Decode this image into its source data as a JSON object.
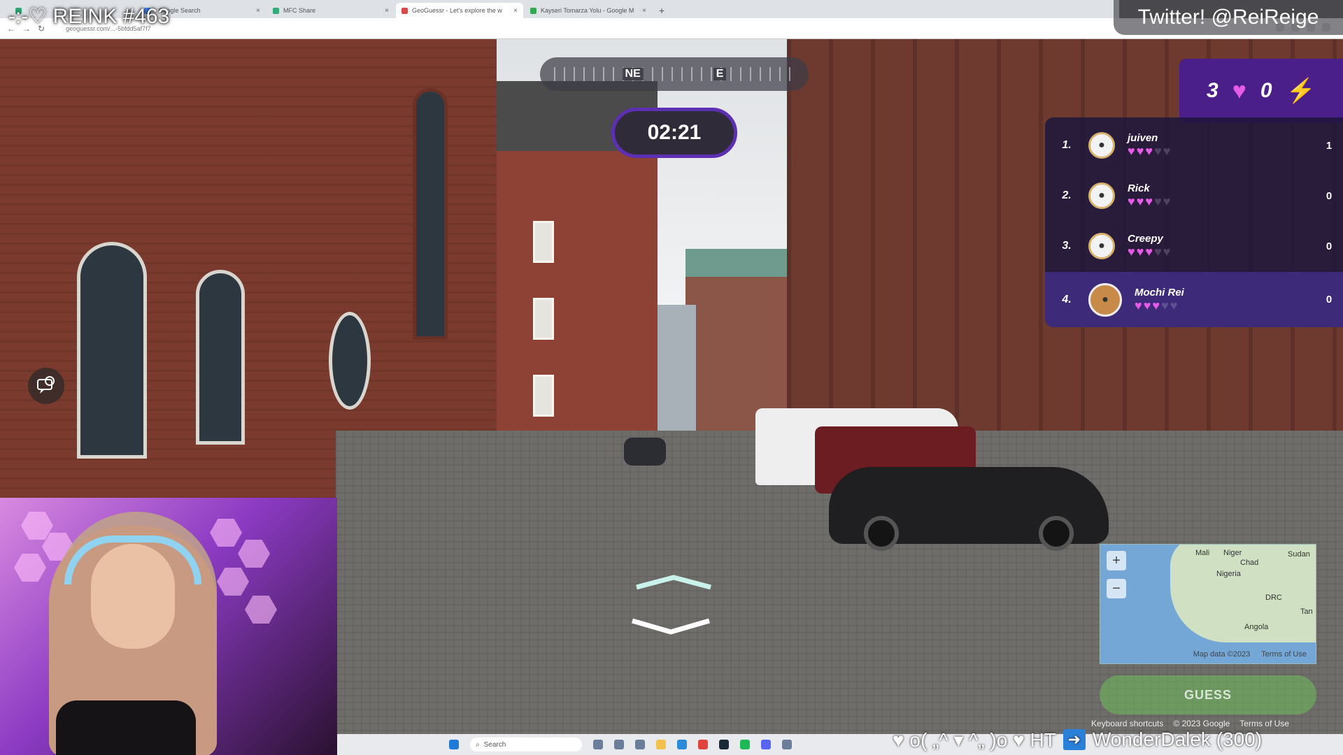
{
  "browser": {
    "tabs": [
      {
        "title": "",
        "active": false
      },
      {
        "title": "- Google Search",
        "active": false
      },
      {
        "title": "MFC Share",
        "active": false
      },
      {
        "title": "GeoGuessr - Let's explore the w",
        "active": true
      },
      {
        "title": "Kayseri Tomarza Yolu - Google M",
        "active": false
      }
    ],
    "url": "geoguessr.com/...-5bfdd5af7f7"
  },
  "game": {
    "compass": {
      "left": "NE",
      "right": "E"
    },
    "timer": "02:21",
    "lives": "3",
    "streak": "0",
    "leaderboard": [
      {
        "rank": "1.",
        "name": "juiven",
        "hearts_full": 3,
        "hearts_total": 5,
        "score": "1"
      },
      {
        "rank": "2.",
        "name": "Rick",
        "hearts_full": 3,
        "hearts_total": 5,
        "score": "0"
      },
      {
        "rank": "3.",
        "name": "Creepy",
        "hearts_full": 3,
        "hearts_total": 5,
        "score": "0"
      },
      {
        "rank": "4.",
        "name": "Mochi Rei",
        "hearts_full": 3,
        "hearts_total": 5,
        "score": "0"
      }
    ],
    "map": {
      "labels": [
        "Mali",
        "Niger",
        "Sudan",
        "Chad",
        "Nigeria",
        "DRC",
        "Angola",
        "Tan"
      ],
      "footer": {
        "data": "Map data ©2023",
        "terms": "Terms of Use"
      },
      "zoom_in": "+",
      "zoom_out": "−"
    },
    "guess_label": "GUESS",
    "google_footer": {
      "shortcuts": "Keyboard shortcuts",
      "copyright": "© 2023 Google",
      "terms": "Terms of Use"
    }
  },
  "taskbar": {
    "search_placeholder": "Search"
  },
  "stream": {
    "title": "-:-♡ REINK #463",
    "twitter": "Twitter! @ReiReige",
    "ticker_left": "♥ o( „^ ▾ ^„ )o ♥ HT",
    "ticker_right": "WonderDalek (300)"
  },
  "colors": {
    "accent": "#5d2fb3",
    "heart": "#e65be8",
    "bolt": "#ffd23a",
    "board_bg": "#1e163c"
  }
}
